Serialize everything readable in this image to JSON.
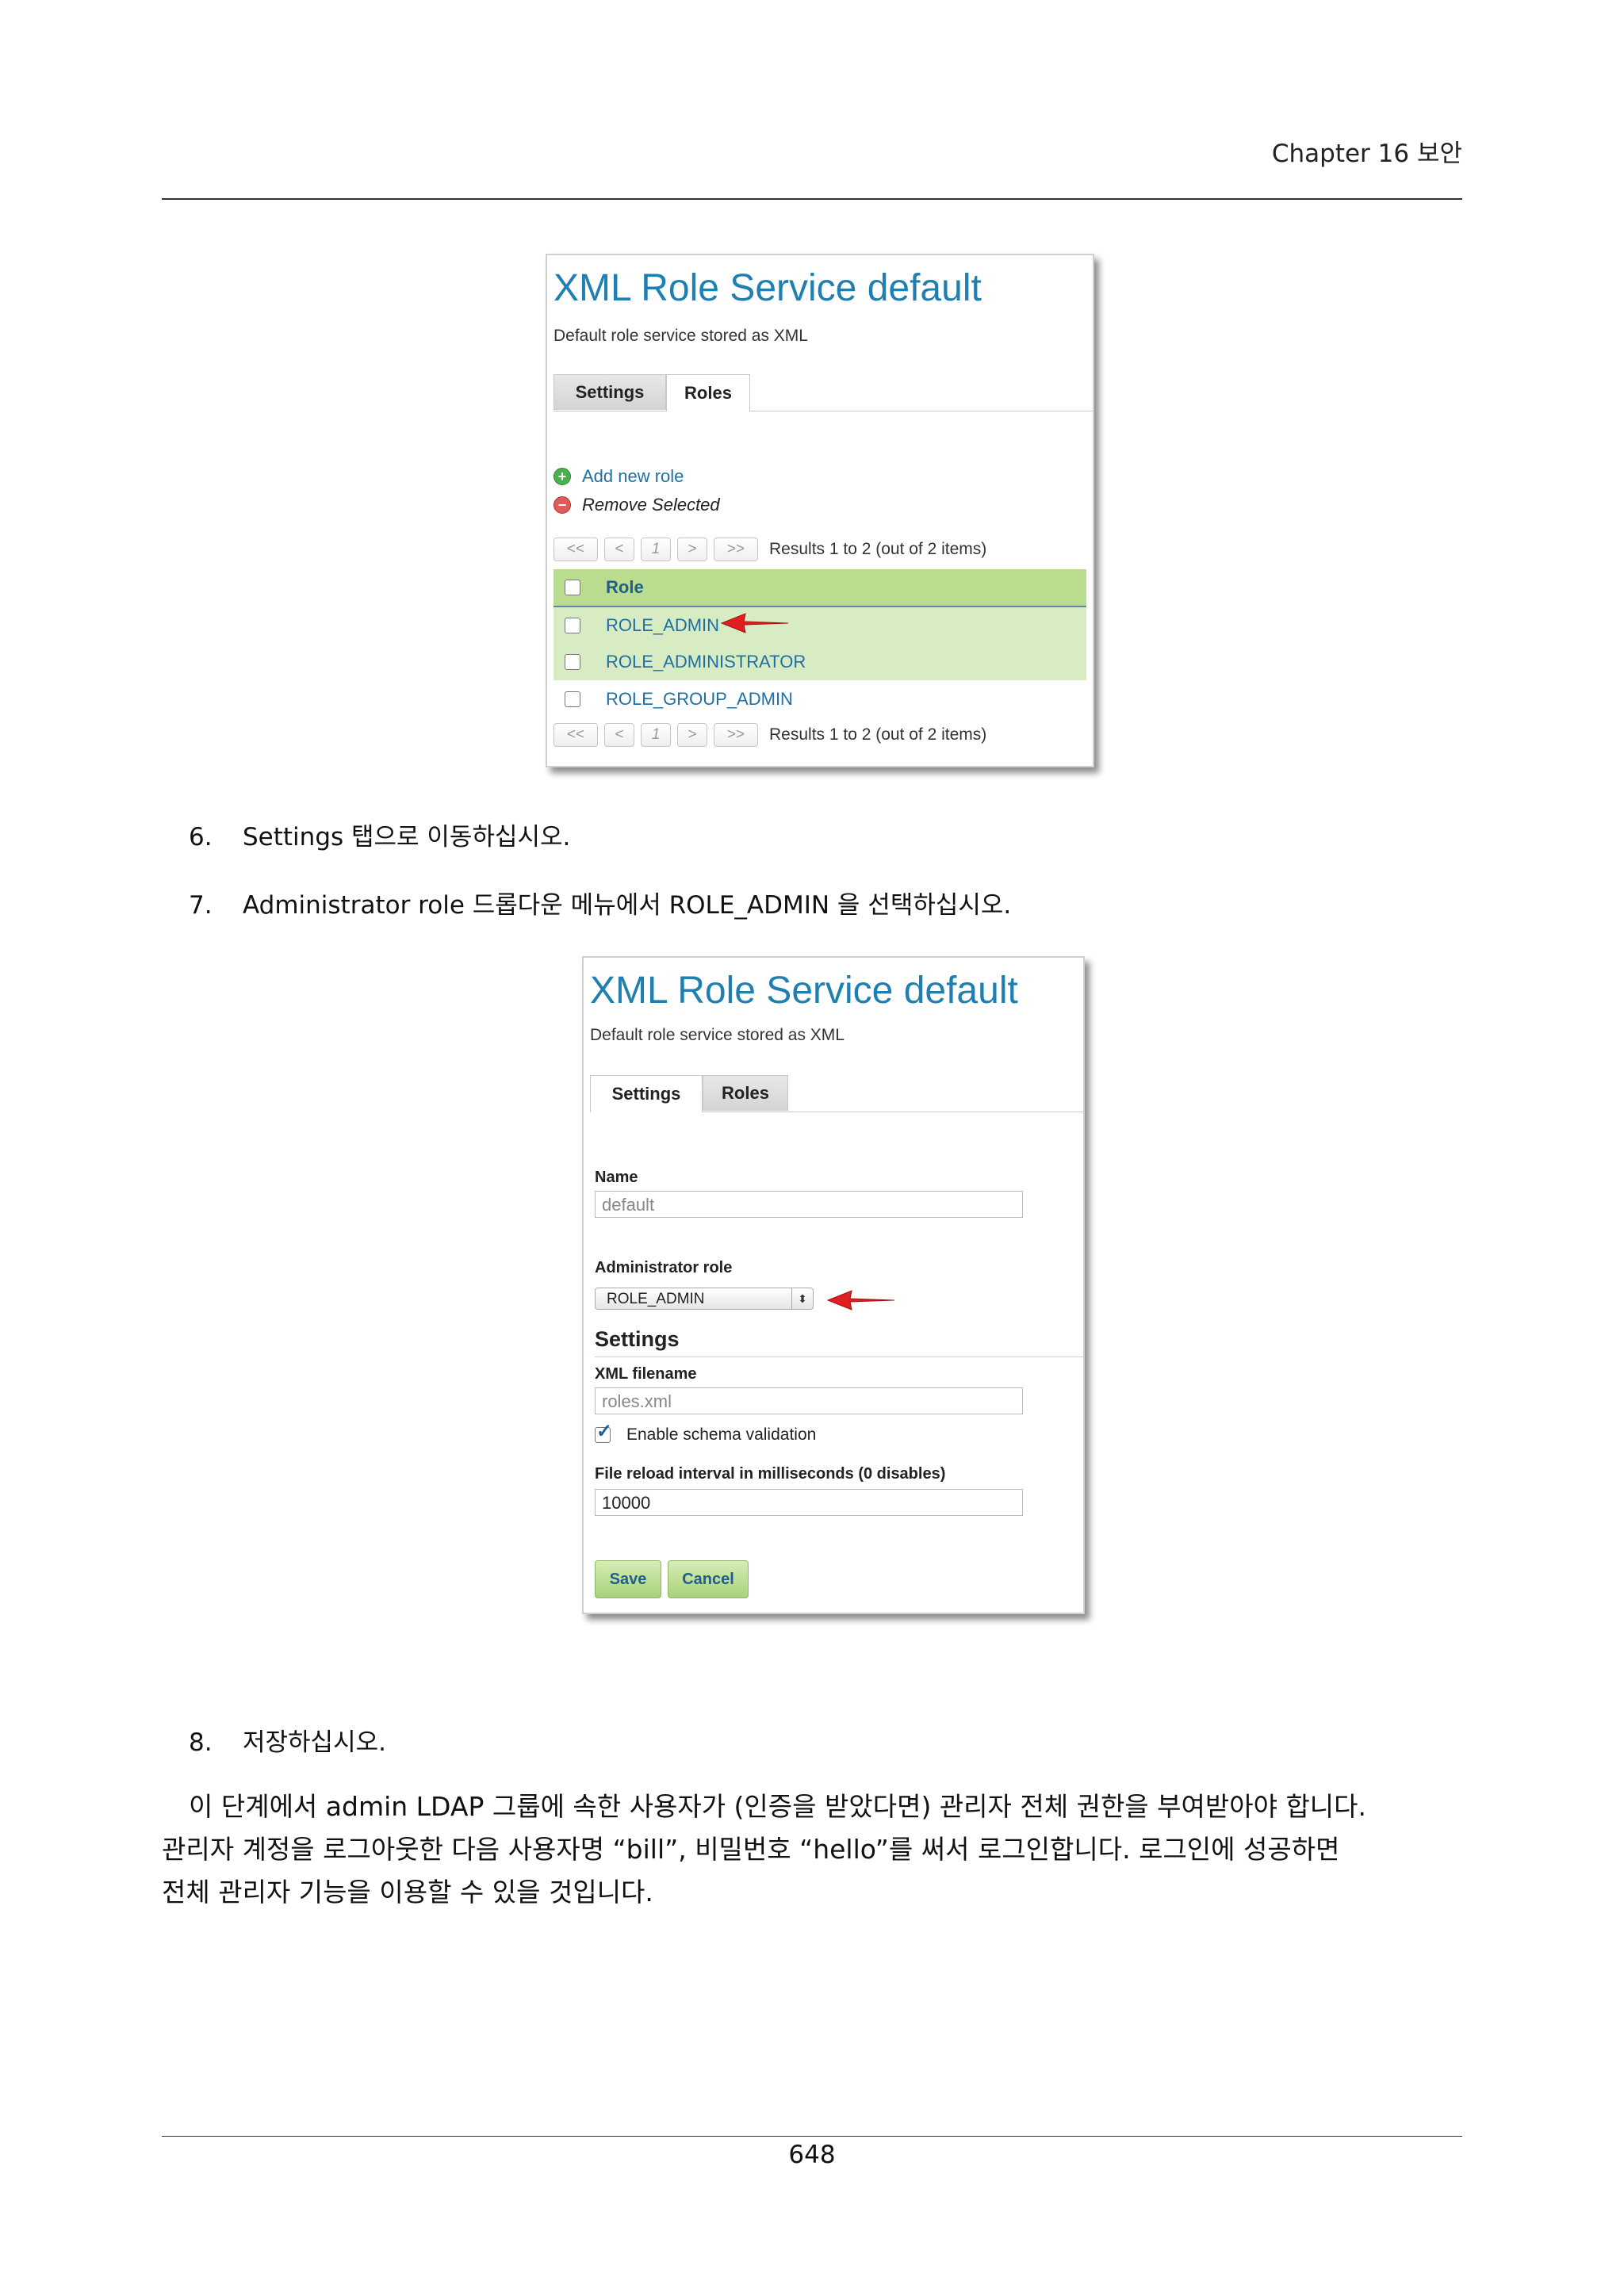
{
  "header": {
    "chapter": "Chapter 16  보안"
  },
  "screenshot1": {
    "title": "XML Role Service default",
    "subtitle": "Default role service stored as XML",
    "tabs": [
      "Settings",
      "Roles"
    ],
    "active_tab": "Roles",
    "add_link": "Add new role",
    "remove_link": "Remove Selected",
    "pager": {
      "first": "<<",
      "prev": "<",
      "page": "1",
      "next": ">",
      "last": ">>",
      "results": "Results 1 to 2 (out of 2 items)"
    },
    "table": {
      "header": "Role",
      "rows": [
        "ROLE_ADMIN",
        "ROLE_ADMINISTRATOR",
        "ROLE_GROUP_ADMIN"
      ]
    }
  },
  "steps": [
    {
      "num": "6.",
      "text": "Settings 탭으로 이동하십시오."
    },
    {
      "num": "7.",
      "text": "Administrator role 드롭다운 메뉴에서 ROLE_ADMIN 을 선택하십시오."
    },
    {
      "num": "8.",
      "text": "저장하십시오."
    }
  ],
  "screenshot2": {
    "title": "XML Role Service default",
    "subtitle": "Default role service stored as XML",
    "tabs": [
      "Settings",
      "Roles"
    ],
    "active_tab": "Settings",
    "name_label": "Name",
    "name_value": "default",
    "admin_role_label": "Administrator role",
    "admin_role_value": "ROLE_ADMIN",
    "section": "Settings",
    "xml_filename_label": "XML filename",
    "xml_filename_value": "roles.xml",
    "schema_validation_label": "Enable schema validation",
    "schema_validation_checked": true,
    "reload_label": "File reload interval in milliseconds (0 disables)",
    "reload_value": "10000",
    "save_button": "Save",
    "cancel_button": "Cancel"
  },
  "paragraph": [
    "이 단계에서 admin LDAP 그룹에 속한 사용자가 (인증을 받았다면) 관리자 전체 권한을 부여받아야 합니다.",
    "관리자 계정을 로그아웃한 다음 사용자명 “bill”, 비밀번호 “hello”를 써서 로그인합니다. 로그인에 성공하면",
    "전체 관리자 기능을 이용할 수 있을 것입니다."
  ],
  "footer": {
    "page_number": "648"
  },
  "colors": {
    "title_blue": "#1f7fb0",
    "table_green": "#b9dc8e",
    "arrow_red": "#e02020"
  }
}
